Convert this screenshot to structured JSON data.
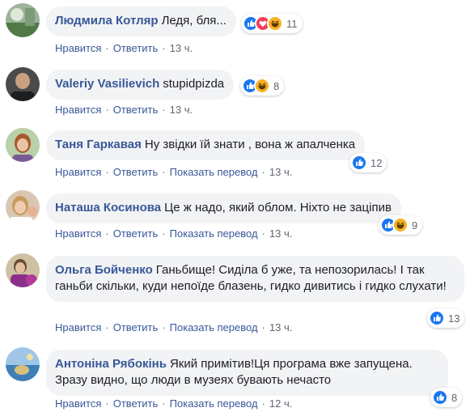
{
  "colors": {
    "link": "#385898",
    "bubble": "#f2f3f5",
    "meta": "#606770",
    "like": "#1877f2",
    "love": "#f33e58",
    "haha": "#f7b125"
  },
  "actions": {
    "like": "Нравится",
    "reply": "Ответить",
    "translate": "Показать перевод"
  },
  "comments": [
    {
      "author": "Людмила Котляр",
      "text": "Ледя, бля...",
      "time": "13 ч.",
      "reactions": [
        "like-icon",
        "love-icon",
        "haha-icon"
      ],
      "count": "11",
      "translate": false
    },
    {
      "author": "Valeriy Vasilievich",
      "text": "stupidpizda",
      "time": "13 ч.",
      "reactions": [
        "like-icon",
        "haha-icon"
      ],
      "count": "8",
      "translate": false
    },
    {
      "author": "Таня Гаркавая",
      "text": "Ну звідки їй знати , вона ж апалченка",
      "time": "13 ч.",
      "reactions": [
        "like-icon"
      ],
      "count": "12",
      "translate": true
    },
    {
      "author": "Наташа Косинова",
      "text": "Це ж надо, який облом. Ніхто не заціпив",
      "time": "13 ч.",
      "reactions": [
        "like-icon",
        "haha-icon"
      ],
      "count": "9",
      "translate": true
    },
    {
      "author": "Ольга Бойченко",
      "text": "Ганьбище! Сиділа б уже, та непозорилась! І так ганьби скільки, куди непоїде блазень, гидко дивитись і гидко слухати!",
      "time": "13 ч.",
      "reactions": [
        "like-icon"
      ],
      "count": "13",
      "translate": true
    },
    {
      "author": "Антоніна Рябокінь",
      "text": "Який примітив!Ця програма вже запущена. Зразу видно, що люди в музеях бувають нечасто",
      "time": "12 ч.",
      "reactions": [
        "like-icon"
      ],
      "count": "8",
      "translate": true
    }
  ]
}
